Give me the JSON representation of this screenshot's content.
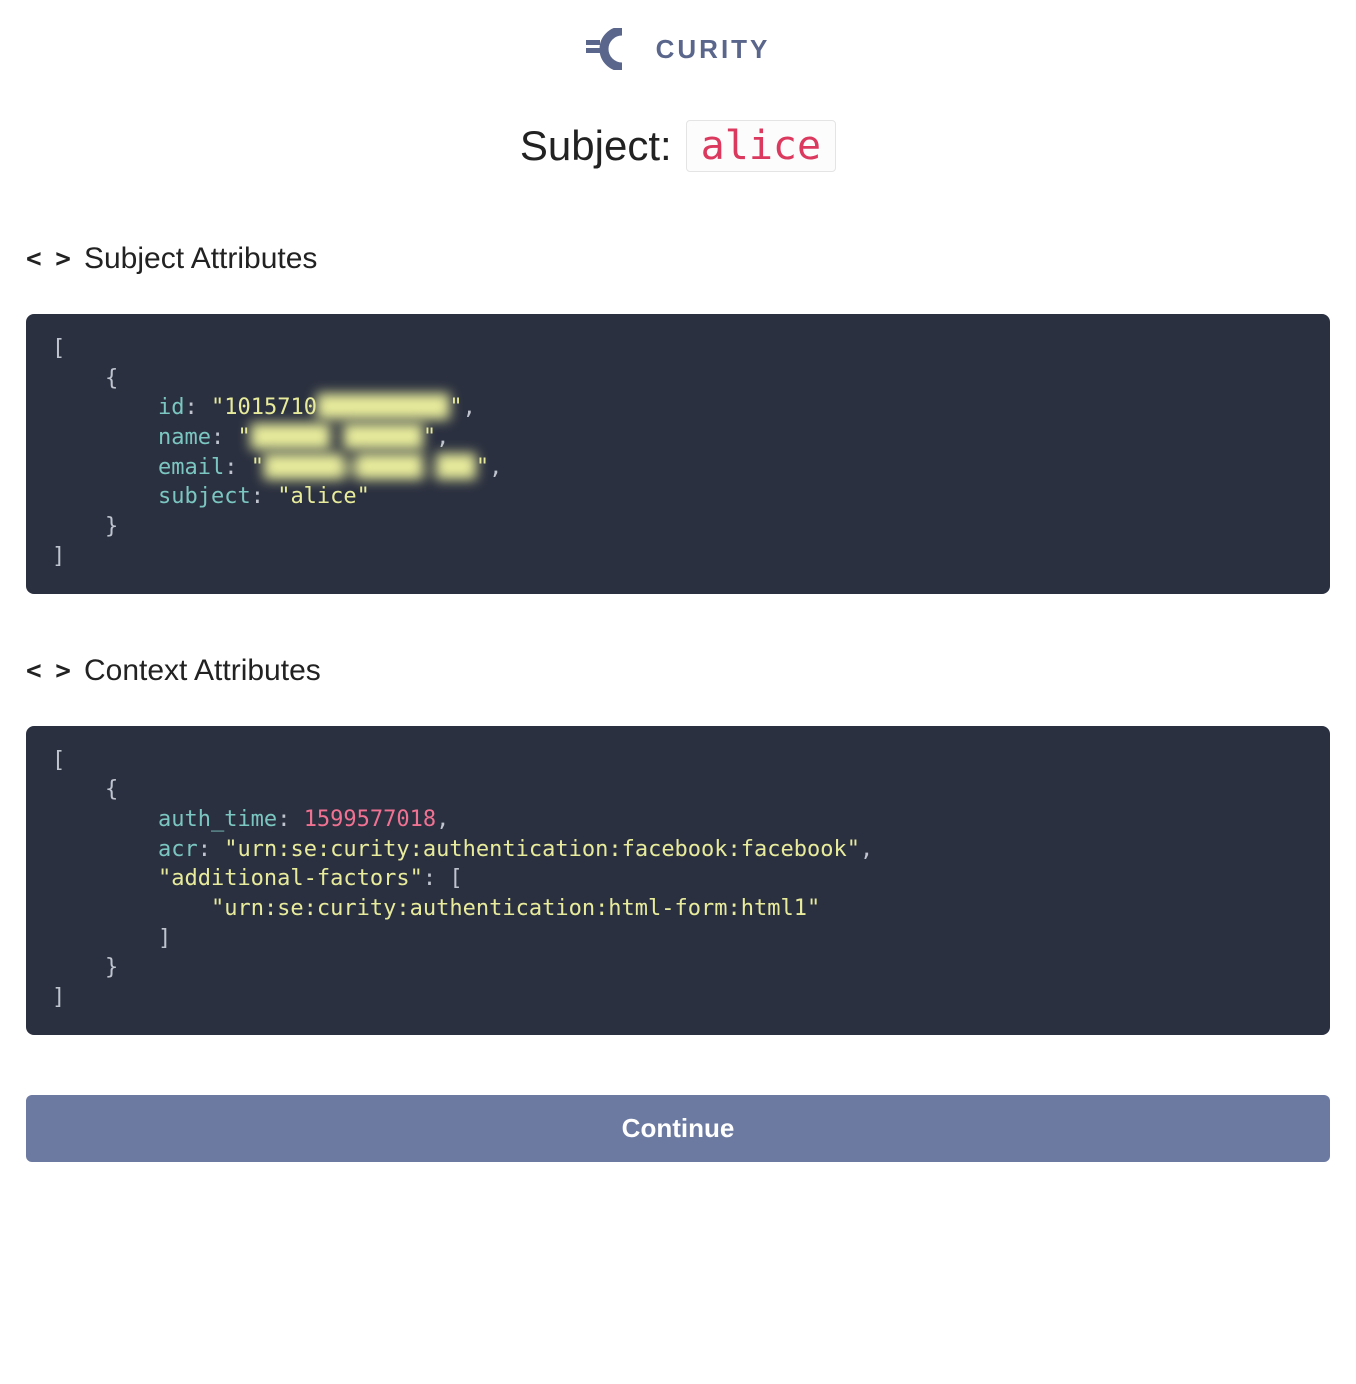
{
  "brand": {
    "name": "CURITY"
  },
  "title": {
    "label": "Subject:",
    "value": "alice"
  },
  "subject_attributes": {
    "heading": "Subject Attributes",
    "items": [
      {
        "id_prefix": "1015710",
        "id_blurred": "██████████",
        "name_blurred": "██████ ██████",
        "email_blurred": "██████@█████.███",
        "subject": "alice"
      }
    ]
  },
  "context_attributes": {
    "heading": "Context Attributes",
    "items": [
      {
        "auth_time": 1599577018,
        "acr": "urn:se:curity:authentication:facebook:facebook",
        "additional_factors": [
          "urn:se:curity:authentication:html-form:html1"
        ]
      }
    ]
  },
  "actions": {
    "continue_label": "Continue"
  }
}
